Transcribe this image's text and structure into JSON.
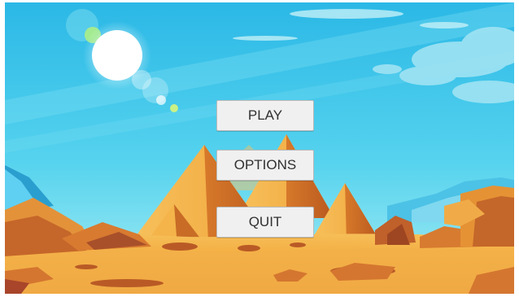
{
  "menu": {
    "play_label": "PLAY",
    "options_label": "OPTIONS",
    "quit_label": "QUIT"
  },
  "scene": {
    "background": "desert-pyramids-illustration",
    "sky_color": "#38c4ea",
    "sand_color": "#f2a83a",
    "pyramid_color": "#f0a038"
  }
}
